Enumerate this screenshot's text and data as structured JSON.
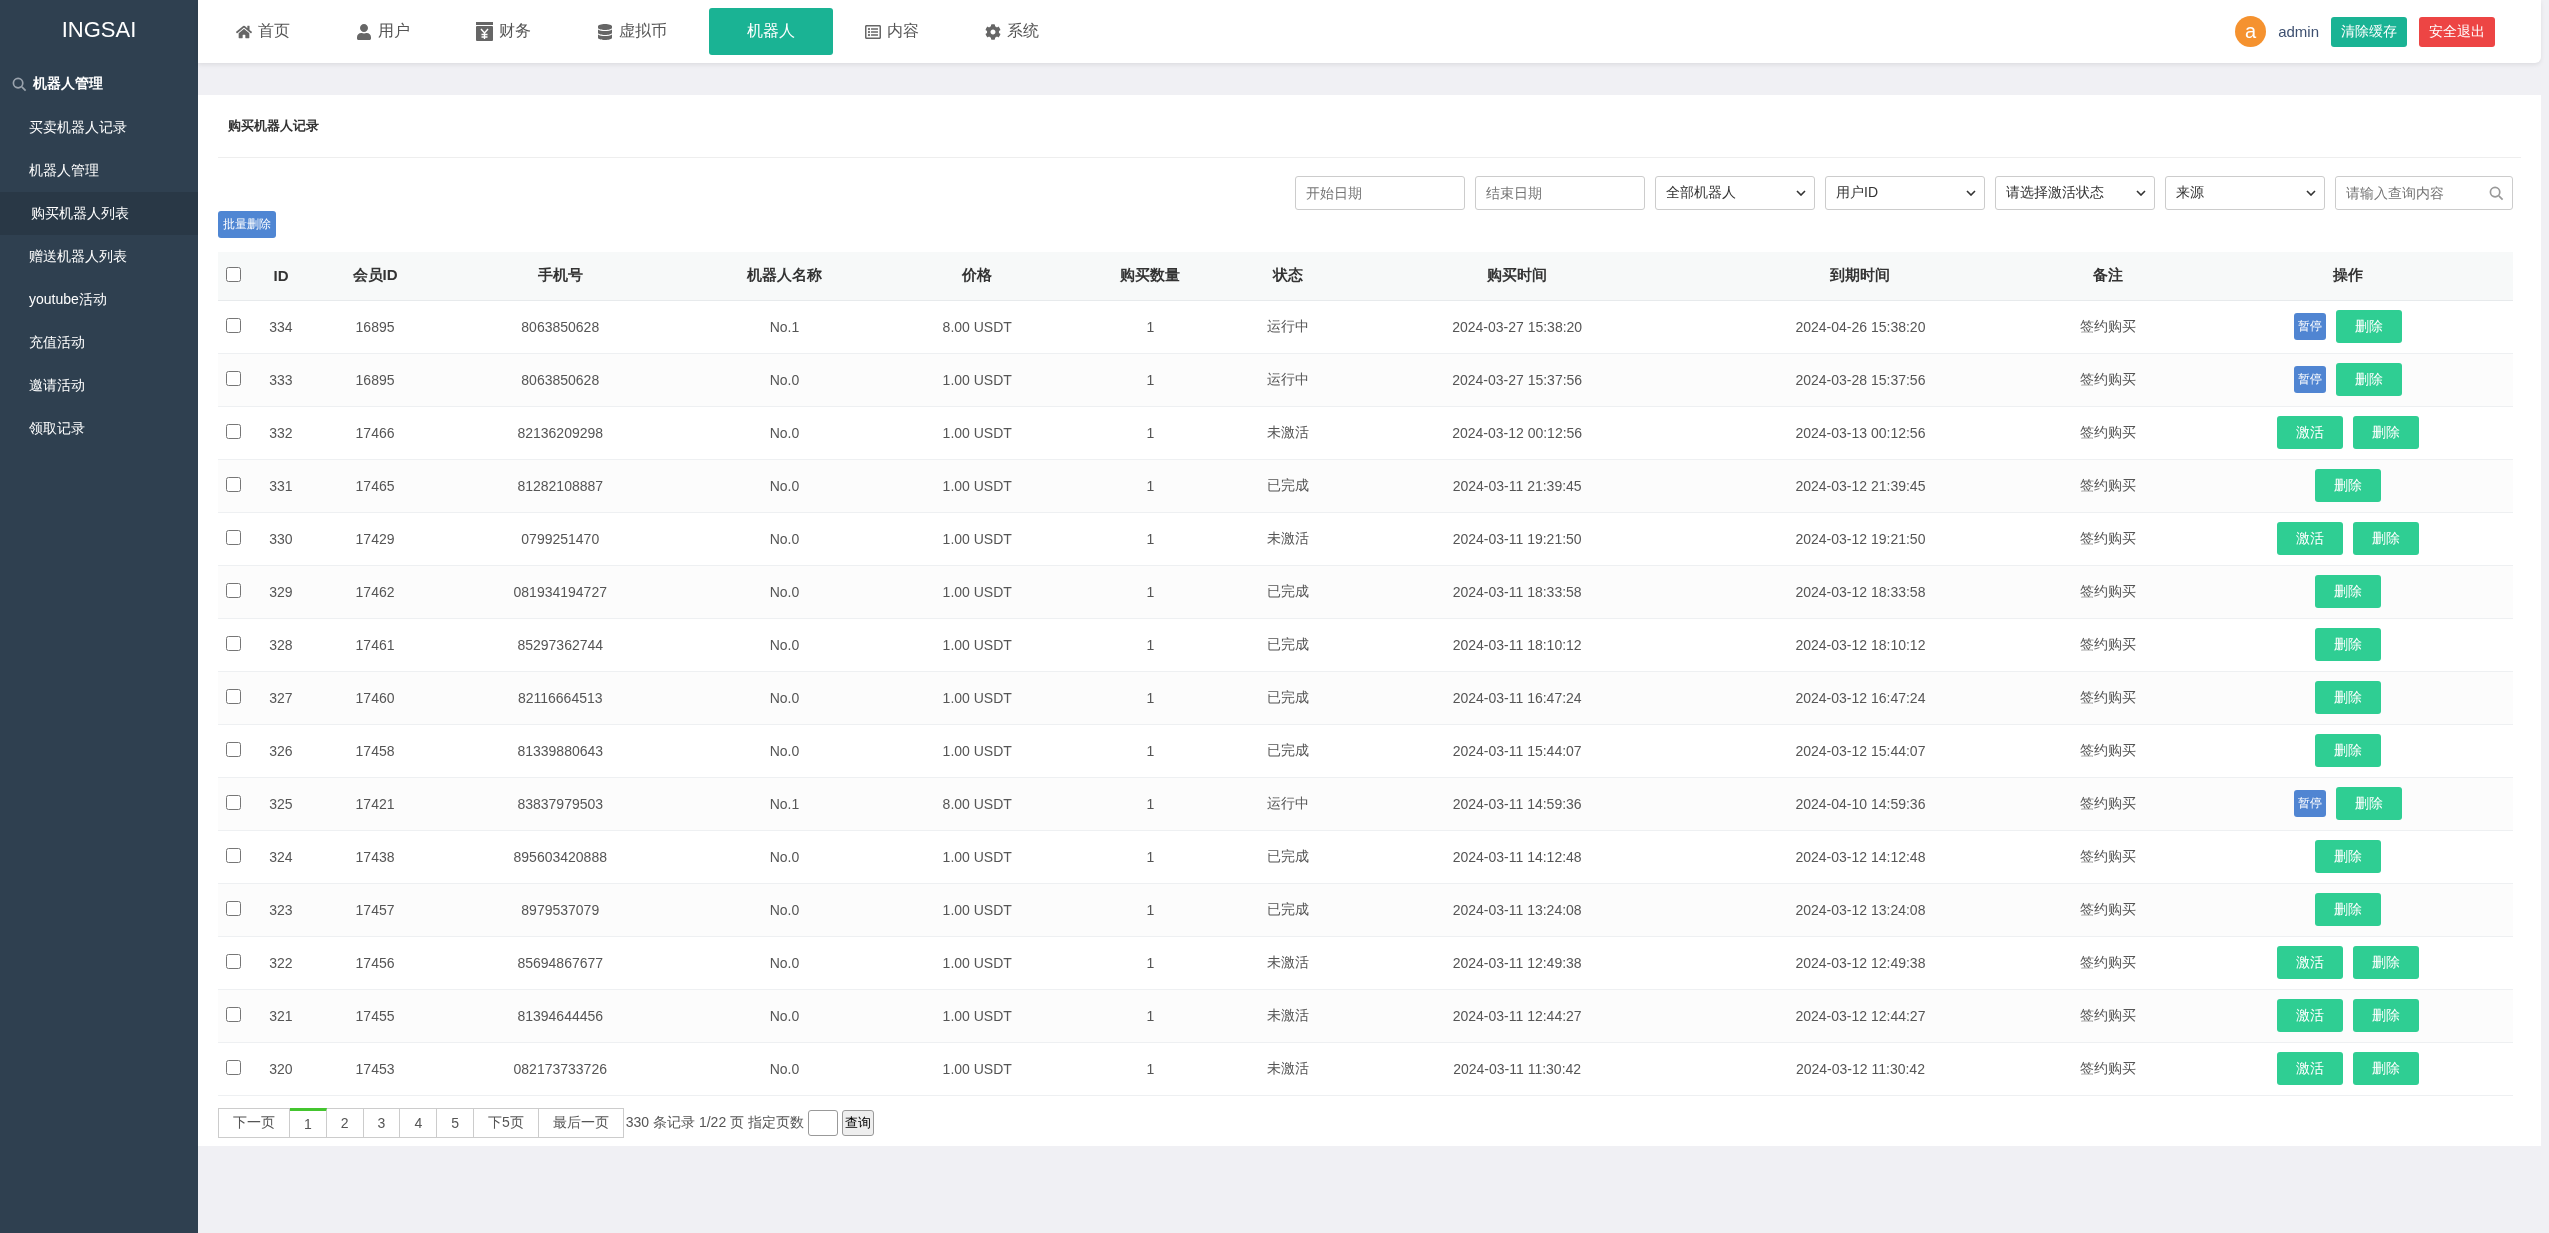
{
  "sidebar": {
    "logo": "INGSAI",
    "section": "机器人管理",
    "items": [
      {
        "label": "买卖机器人记录",
        "selected": false
      },
      {
        "label": "机器人管理",
        "selected": false
      },
      {
        "label": "购买机器人列表",
        "selected": true
      },
      {
        "label": "赠送机器人列表",
        "selected": false
      },
      {
        "label": "youtube活动",
        "selected": false
      },
      {
        "label": "充值活动",
        "selected": false
      },
      {
        "label": "邀请活动",
        "selected": false
      },
      {
        "label": "领取记录",
        "selected": false
      }
    ]
  },
  "topnav": {
    "tabs": [
      {
        "label": "首页",
        "selected": false
      },
      {
        "label": "用户",
        "selected": false
      },
      {
        "label": "财务",
        "selected": false
      },
      {
        "label": "虚拟币",
        "selected": false
      },
      {
        "label": "机器人",
        "selected": true
      },
      {
        "label": "内容",
        "selected": false
      },
      {
        "label": "系统",
        "selected": false
      }
    ],
    "avatar": "a",
    "user": "admin",
    "buttons": [
      {
        "label": "清除缓存",
        "kind": "clear"
      },
      {
        "label": "安全退出",
        "kind": "logout"
      }
    ]
  },
  "panel": {
    "title": "购买机器人记录",
    "filters": [
      {
        "kind": "input",
        "placeholder": "开始日期"
      },
      {
        "kind": "input",
        "placeholder": "结束日期"
      },
      {
        "kind": "select",
        "value": "全部机器人"
      },
      {
        "kind": "select",
        "value": "用户ID"
      },
      {
        "kind": "select",
        "value": "请选择激活状态"
      },
      {
        "kind": "select",
        "value": "来源"
      },
      {
        "kind": "search",
        "placeholder": "请输入查询内容"
      }
    ],
    "bulk_delete": "批量删除",
    "table": {
      "header_checked": false,
      "columns": [
        "ID",
        "会员ID",
        "手机号",
        "机器人名称",
        "价格",
        "购买数量",
        "状态",
        "购买时间",
        "到期时间",
        "备注",
        "操作"
      ],
      "rows": [
        {
          "checked": false,
          "cells": [
            "334",
            "16895",
            "8063850628",
            "No.1",
            "8.00 USDT",
            "1",
            "运行中",
            "2024-03-27 15:38:20",
            "2024-04-26 15:38:20",
            "签约购买"
          ],
          "actions": [
            {
              "kind": "pause",
              "label": "暂停"
            },
            {
              "kind": "delete",
              "label": "删除"
            }
          ]
        },
        {
          "checked": false,
          "cells": [
            "333",
            "16895",
            "8063850628",
            "No.0",
            "1.00 USDT",
            "1",
            "运行中",
            "2024-03-27 15:37:56",
            "2024-03-28 15:37:56",
            "签约购买"
          ],
          "actions": [
            {
              "kind": "pause",
              "label": "暂停"
            },
            {
              "kind": "delete",
              "label": "删除"
            }
          ]
        },
        {
          "checked": false,
          "cells": [
            "332",
            "17466",
            "82136209298",
            "No.0",
            "1.00 USDT",
            "1",
            "未激活",
            "2024-03-12 00:12:56",
            "2024-03-13 00:12:56",
            "签约购买"
          ],
          "actions": [
            {
              "kind": "activate",
              "label": "激活"
            },
            {
              "kind": "delete",
              "label": "删除"
            }
          ]
        },
        {
          "checked": false,
          "cells": [
            "331",
            "17465",
            "81282108887",
            "No.0",
            "1.00 USDT",
            "1",
            "已完成",
            "2024-03-11 21:39:45",
            "2024-03-12 21:39:45",
            "签约购买"
          ],
          "actions": [
            {
              "kind": "delete",
              "label": "删除"
            }
          ]
        },
        {
          "checked": false,
          "cells": [
            "330",
            "17429",
            "0799251470",
            "No.0",
            "1.00 USDT",
            "1",
            "未激活",
            "2024-03-11 19:21:50",
            "2024-03-12 19:21:50",
            "签约购买"
          ],
          "actions": [
            {
              "kind": "activate",
              "label": "激活"
            },
            {
              "kind": "delete",
              "label": "删除"
            }
          ]
        },
        {
          "checked": false,
          "cells": [
            "329",
            "17462",
            "081934194727",
            "No.0",
            "1.00 USDT",
            "1",
            "已完成",
            "2024-03-11 18:33:58",
            "2024-03-12 18:33:58",
            "签约购买"
          ],
          "actions": [
            {
              "kind": "delete",
              "label": "删除"
            }
          ]
        },
        {
          "checked": false,
          "cells": [
            "328",
            "17461",
            "85297362744",
            "No.0",
            "1.00 USDT",
            "1",
            "已完成",
            "2024-03-11 18:10:12",
            "2024-03-12 18:10:12",
            "签约购买"
          ],
          "actions": [
            {
              "kind": "delete",
              "label": "删除"
            }
          ]
        },
        {
          "checked": false,
          "cells": [
            "327",
            "17460",
            "82116664513",
            "No.0",
            "1.00 USDT",
            "1",
            "已完成",
            "2024-03-11 16:47:24",
            "2024-03-12 16:47:24",
            "签约购买"
          ],
          "actions": [
            {
              "kind": "delete",
              "label": "删除"
            }
          ]
        },
        {
          "checked": false,
          "cells": [
            "326",
            "17458",
            "81339880643",
            "No.0",
            "1.00 USDT",
            "1",
            "已完成",
            "2024-03-11 15:44:07",
            "2024-03-12 15:44:07",
            "签约购买"
          ],
          "actions": [
            {
              "kind": "delete",
              "label": "删除"
            }
          ]
        },
        {
          "checked": false,
          "cells": [
            "325",
            "17421",
            "83837979503",
            "No.1",
            "8.00 USDT",
            "1",
            "运行中",
            "2024-03-11 14:59:36",
            "2024-04-10 14:59:36",
            "签约购买"
          ],
          "actions": [
            {
              "kind": "pause",
              "label": "暂停"
            },
            {
              "kind": "delete",
              "label": "删除"
            }
          ]
        },
        {
          "checked": false,
          "cells": [
            "324",
            "17438",
            "895603420888",
            "No.0",
            "1.00 USDT",
            "1",
            "已完成",
            "2024-03-11 14:12:48",
            "2024-03-12 14:12:48",
            "签约购买"
          ],
          "actions": [
            {
              "kind": "delete",
              "label": "删除"
            }
          ]
        },
        {
          "checked": false,
          "cells": [
            "323",
            "17457",
            "8979537079",
            "No.0",
            "1.00 USDT",
            "1",
            "已完成",
            "2024-03-11 13:24:08",
            "2024-03-12 13:24:08",
            "签约购买"
          ],
          "actions": [
            {
              "kind": "delete",
              "label": "删除"
            }
          ]
        },
        {
          "checked": false,
          "cells": [
            "322",
            "17456",
            "85694867677",
            "No.0",
            "1.00 USDT",
            "1",
            "未激活",
            "2024-03-11 12:49:38",
            "2024-03-12 12:49:38",
            "签约购买"
          ],
          "actions": [
            {
              "kind": "activate",
              "label": "激活"
            },
            {
              "kind": "delete",
              "label": "删除"
            }
          ]
        },
        {
          "checked": false,
          "cells": [
            "321",
            "17455",
            "81394644456",
            "No.0",
            "1.00 USDT",
            "1",
            "未激活",
            "2024-03-11 12:44:27",
            "2024-03-12 12:44:27",
            "签约购买"
          ],
          "actions": [
            {
              "kind": "activate",
              "label": "激活"
            },
            {
              "kind": "delete",
              "label": "删除"
            }
          ]
        },
        {
          "checked": false,
          "cells": [
            "320",
            "17453",
            "082173733726",
            "No.0",
            "1.00 USDT",
            "1",
            "未激活",
            "2024-03-11 11:30:42",
            "2024-03-12 11:30:42",
            "签约购买"
          ],
          "actions": [
            {
              "kind": "activate",
              "label": "激活"
            },
            {
              "kind": "delete",
              "label": "删除"
            }
          ]
        }
      ]
    },
    "pagination": {
      "pages": [
        {
          "label": "下一页",
          "selected": false
        },
        {
          "label": "1",
          "selected": true
        },
        {
          "label": "2",
          "selected": false
        },
        {
          "label": "3",
          "selected": false
        },
        {
          "label": "4",
          "selected": false
        },
        {
          "label": "5",
          "selected": false
        },
        {
          "label": "下5页",
          "selected": false
        },
        {
          "label": "最后一页",
          "selected": false
        }
      ],
      "info": "330 条记录 1/22 页 指定页数",
      "go": "查询"
    }
  }
}
